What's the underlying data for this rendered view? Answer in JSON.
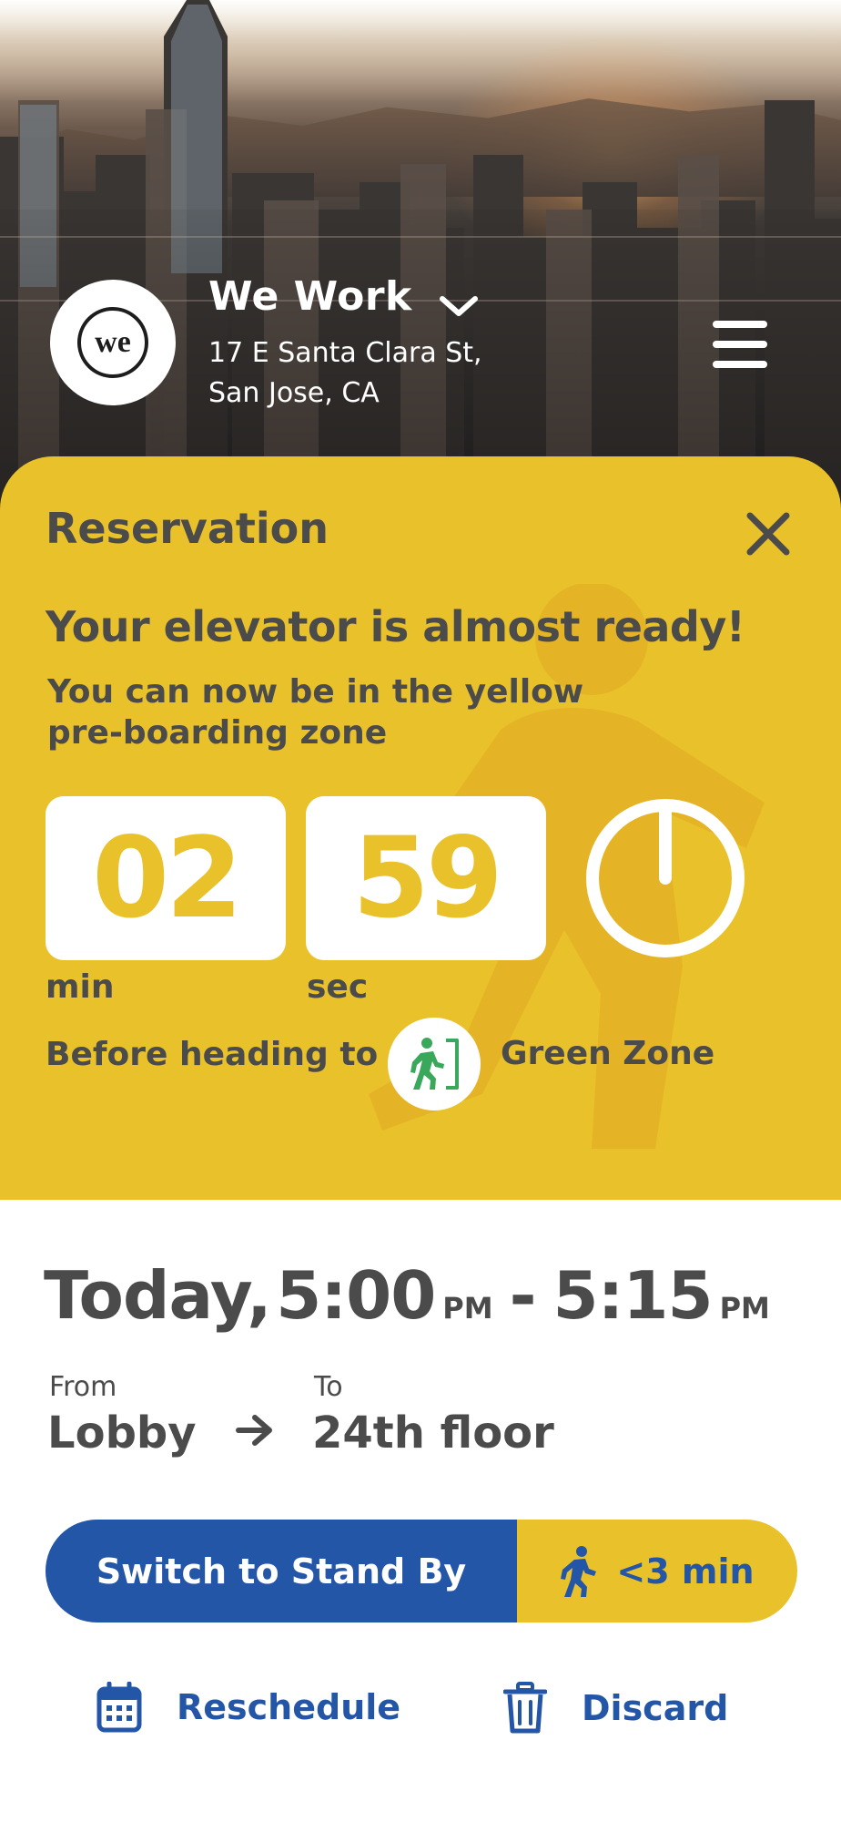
{
  "header": {
    "logo_text": "we",
    "title": "We Work",
    "address_line1": "17 E Santa Clara St,",
    "address_line2": "San Jose, CA"
  },
  "reservation": {
    "title": "Reservation",
    "headline": "Your elevator is almost ready!",
    "subline": "You can now be in the yellow pre-boarding zone",
    "countdown": {
      "minutes": "02",
      "minutes_unit": "min",
      "seconds": "59",
      "seconds_unit": "sec"
    },
    "before_text": "Before heading to",
    "zone_name": "Green Zone"
  },
  "trip": {
    "day": "Today,",
    "start_time": "5:00",
    "start_ampm": "PM",
    "separator": "-",
    "end_time": "5:15",
    "end_ampm": "PM",
    "from_label": "From",
    "from_value": "Lobby",
    "to_label": "To",
    "to_value": "24th floor"
  },
  "actions": {
    "standby_label": "Switch to Stand By",
    "eta_label": "<3 min",
    "reschedule_label": "Reschedule",
    "discard_label": "Discard"
  },
  "colors": {
    "accent_yellow": "#e9c22b",
    "primary_blue": "#2456a8",
    "text_dark": "#4b4b4b",
    "zone_green": "#3aa85a"
  }
}
